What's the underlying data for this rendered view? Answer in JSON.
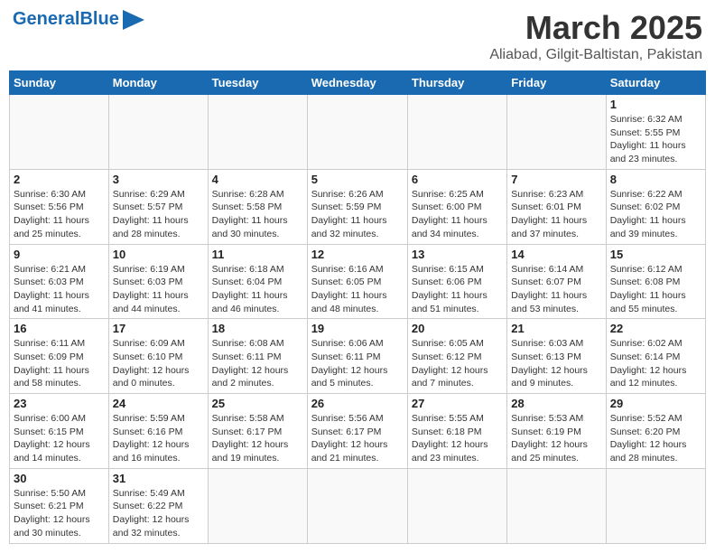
{
  "header": {
    "logo_general": "General",
    "logo_blue": "Blue",
    "month_title": "March 2025",
    "subtitle": "Aliabad, Gilgit-Baltistan, Pakistan"
  },
  "weekdays": [
    "Sunday",
    "Monday",
    "Tuesday",
    "Wednesday",
    "Thursday",
    "Friday",
    "Saturday"
  ],
  "weeks": [
    [
      {
        "day": "",
        "info": ""
      },
      {
        "day": "",
        "info": ""
      },
      {
        "day": "",
        "info": ""
      },
      {
        "day": "",
        "info": ""
      },
      {
        "day": "",
        "info": ""
      },
      {
        "day": "",
        "info": ""
      },
      {
        "day": "1",
        "info": "Sunrise: 6:32 AM\nSunset: 5:55 PM\nDaylight: 11 hours\nand 23 minutes."
      }
    ],
    [
      {
        "day": "2",
        "info": "Sunrise: 6:30 AM\nSunset: 5:56 PM\nDaylight: 11 hours\nand 25 minutes."
      },
      {
        "day": "3",
        "info": "Sunrise: 6:29 AM\nSunset: 5:57 PM\nDaylight: 11 hours\nand 28 minutes."
      },
      {
        "day": "4",
        "info": "Sunrise: 6:28 AM\nSunset: 5:58 PM\nDaylight: 11 hours\nand 30 minutes."
      },
      {
        "day": "5",
        "info": "Sunrise: 6:26 AM\nSunset: 5:59 PM\nDaylight: 11 hours\nand 32 minutes."
      },
      {
        "day": "6",
        "info": "Sunrise: 6:25 AM\nSunset: 6:00 PM\nDaylight: 11 hours\nand 34 minutes."
      },
      {
        "day": "7",
        "info": "Sunrise: 6:23 AM\nSunset: 6:01 PM\nDaylight: 11 hours\nand 37 minutes."
      },
      {
        "day": "8",
        "info": "Sunrise: 6:22 AM\nSunset: 6:02 PM\nDaylight: 11 hours\nand 39 minutes."
      }
    ],
    [
      {
        "day": "9",
        "info": "Sunrise: 6:21 AM\nSunset: 6:03 PM\nDaylight: 11 hours\nand 41 minutes."
      },
      {
        "day": "10",
        "info": "Sunrise: 6:19 AM\nSunset: 6:03 PM\nDaylight: 11 hours\nand 44 minutes."
      },
      {
        "day": "11",
        "info": "Sunrise: 6:18 AM\nSunset: 6:04 PM\nDaylight: 11 hours\nand 46 minutes."
      },
      {
        "day": "12",
        "info": "Sunrise: 6:16 AM\nSunset: 6:05 PM\nDaylight: 11 hours\nand 48 minutes."
      },
      {
        "day": "13",
        "info": "Sunrise: 6:15 AM\nSunset: 6:06 PM\nDaylight: 11 hours\nand 51 minutes."
      },
      {
        "day": "14",
        "info": "Sunrise: 6:14 AM\nSunset: 6:07 PM\nDaylight: 11 hours\nand 53 minutes."
      },
      {
        "day": "15",
        "info": "Sunrise: 6:12 AM\nSunset: 6:08 PM\nDaylight: 11 hours\nand 55 minutes."
      }
    ],
    [
      {
        "day": "16",
        "info": "Sunrise: 6:11 AM\nSunset: 6:09 PM\nDaylight: 11 hours\nand 58 minutes."
      },
      {
        "day": "17",
        "info": "Sunrise: 6:09 AM\nSunset: 6:10 PM\nDaylight: 12 hours\nand 0 minutes."
      },
      {
        "day": "18",
        "info": "Sunrise: 6:08 AM\nSunset: 6:11 PM\nDaylight: 12 hours\nand 2 minutes."
      },
      {
        "day": "19",
        "info": "Sunrise: 6:06 AM\nSunset: 6:11 PM\nDaylight: 12 hours\nand 5 minutes."
      },
      {
        "day": "20",
        "info": "Sunrise: 6:05 AM\nSunset: 6:12 PM\nDaylight: 12 hours\nand 7 minutes."
      },
      {
        "day": "21",
        "info": "Sunrise: 6:03 AM\nSunset: 6:13 PM\nDaylight: 12 hours\nand 9 minutes."
      },
      {
        "day": "22",
        "info": "Sunrise: 6:02 AM\nSunset: 6:14 PM\nDaylight: 12 hours\nand 12 minutes."
      }
    ],
    [
      {
        "day": "23",
        "info": "Sunrise: 6:00 AM\nSunset: 6:15 PM\nDaylight: 12 hours\nand 14 minutes."
      },
      {
        "day": "24",
        "info": "Sunrise: 5:59 AM\nSunset: 6:16 PM\nDaylight: 12 hours\nand 16 minutes."
      },
      {
        "day": "25",
        "info": "Sunrise: 5:58 AM\nSunset: 6:17 PM\nDaylight: 12 hours\nand 19 minutes."
      },
      {
        "day": "26",
        "info": "Sunrise: 5:56 AM\nSunset: 6:17 PM\nDaylight: 12 hours\nand 21 minutes."
      },
      {
        "day": "27",
        "info": "Sunrise: 5:55 AM\nSunset: 6:18 PM\nDaylight: 12 hours\nand 23 minutes."
      },
      {
        "day": "28",
        "info": "Sunrise: 5:53 AM\nSunset: 6:19 PM\nDaylight: 12 hours\nand 25 minutes."
      },
      {
        "day": "29",
        "info": "Sunrise: 5:52 AM\nSunset: 6:20 PM\nDaylight: 12 hours\nand 28 minutes."
      }
    ],
    [
      {
        "day": "30",
        "info": "Sunrise: 5:50 AM\nSunset: 6:21 PM\nDaylight: 12 hours\nand 30 minutes."
      },
      {
        "day": "31",
        "info": "Sunrise: 5:49 AM\nSunset: 6:22 PM\nDaylight: 12 hours\nand 32 minutes."
      },
      {
        "day": "",
        "info": ""
      },
      {
        "day": "",
        "info": ""
      },
      {
        "day": "",
        "info": ""
      },
      {
        "day": "",
        "info": ""
      },
      {
        "day": "",
        "info": ""
      }
    ]
  ]
}
